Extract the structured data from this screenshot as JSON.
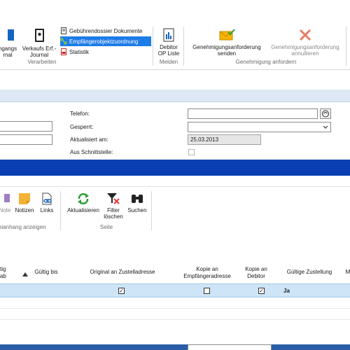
{
  "ribbon": {
    "eingangs_label": "ngangs",
    "eingangs_label2": "rnal",
    "verkaufs_label": "Verkaufs Erf.-",
    "verkaufs_label2": "Journal",
    "small_items": [
      "Gebührendossier Dokumente",
      "Empfängerobjektzuordnung",
      "Statistik"
    ],
    "debitor_label": "Debitor",
    "debitor_label2": "OP Liste",
    "send_label": "Genehmigungsanforderung",
    "send_label2": "senden",
    "cancel_label": "Genehmigungsanforderung",
    "cancel_label2": "annullieren",
    "groups": {
      "verarbeiten": "Verarbeiten",
      "melden": "Melden",
      "genehmigung": "Genehmigung anfordern"
    }
  },
  "form": {
    "telefon_label": "Telefon:",
    "gesperrt_label": "Gesperrt:",
    "aktualisiert_label": "Aktualisiert am:",
    "aktualisiert_value": "25.03.2013",
    "schnittstelle_label": "Aus Schnittstelle:"
  },
  "toolbar2": {
    "note_label": "Note",
    "notizen_label": "Notizen",
    "links_label": "Links",
    "aktualisieren_label": "Aktualisieren",
    "filter_label": "Filter",
    "filter_label2": "löschen",
    "suchen_label": "Suchen",
    "group_anhang": "eianhang anzeigen",
    "group_seite": "Seite"
  },
  "grid": {
    "headers": {
      "col0a": "tig",
      "col0b": "ab",
      "gueltig_bis": "Gültig bis",
      "original": "Original an Zustelladresse",
      "kopie_empf_a": "Kopie an",
      "kopie_empf_b": "Empfängeradresse",
      "kopie_deb_a": "Kopie an",
      "kopie_deb_b": "Debitor",
      "gueltige_zust": "Gültige Zustellung",
      "col_m": "M"
    },
    "row": {
      "original_checked": true,
      "kopie_empf_checked": false,
      "kopie_deb_checked": true,
      "zustellung": "Ja"
    }
  },
  "colors": {
    "accent": "#0a3fb3",
    "selection": "#cde5f7",
    "ribbon_selected": "#1e7ce8"
  }
}
